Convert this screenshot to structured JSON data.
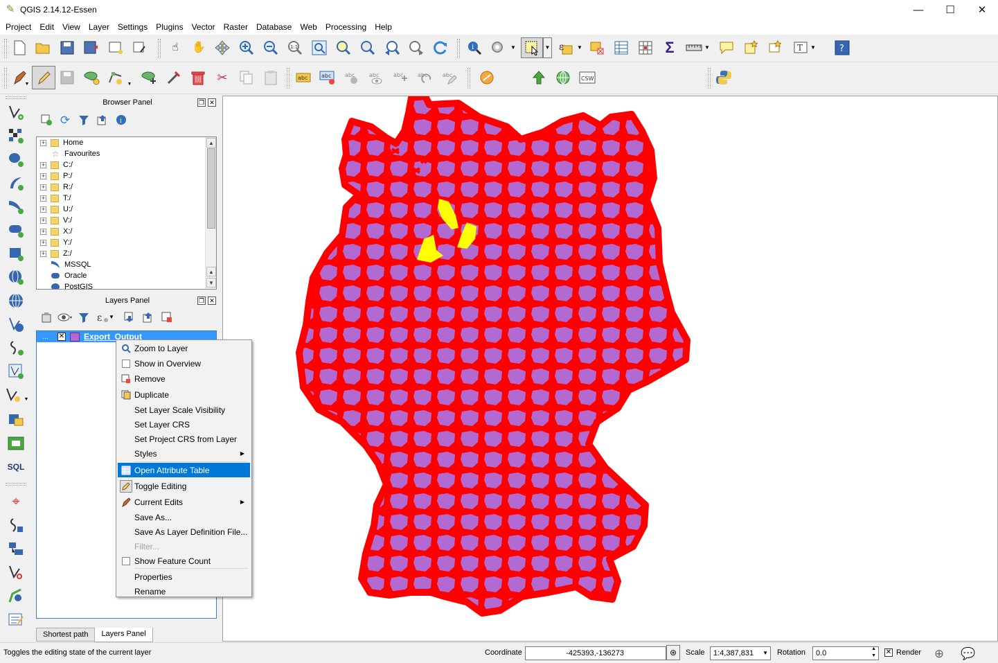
{
  "window": {
    "title": "QGIS 2.14.12-Essen",
    "minimize": "—",
    "maximize": "☐",
    "close": "✕"
  },
  "menu": [
    "Project",
    "Edit",
    "View",
    "Layer",
    "Settings",
    "Plugins",
    "Vector",
    "Raster",
    "Database",
    "Web",
    "Processing",
    "Help"
  ],
  "browser_panel": {
    "title": "Browser Panel",
    "items": [
      {
        "label": "Home",
        "icon": "folder-icon",
        "expandable": true
      },
      {
        "label": "Favourites",
        "icon": "star-icon",
        "expandable": false
      },
      {
        "label": "C:/",
        "icon": "folder-icon",
        "expandable": true
      },
      {
        "label": "P:/",
        "icon": "folder-icon",
        "expandable": true
      },
      {
        "label": "R:/",
        "icon": "folder-icon",
        "expandable": true
      },
      {
        "label": "T:/",
        "icon": "folder-icon",
        "expandable": true
      },
      {
        "label": "U:/",
        "icon": "folder-icon",
        "expandable": true
      },
      {
        "label": "V:/",
        "icon": "folder-icon",
        "expandable": true
      },
      {
        "label": "X:/",
        "icon": "folder-icon",
        "expandable": true
      },
      {
        "label": "Y:/",
        "icon": "folder-icon",
        "expandable": true
      },
      {
        "label": "Z:/",
        "icon": "folder-icon",
        "expandable": true
      },
      {
        "label": "MSSQL",
        "icon": "mssql-icon",
        "expandable": false
      },
      {
        "label": "Oracle",
        "icon": "oracle-icon",
        "expandable": false
      },
      {
        "label": "PostGIS",
        "icon": "postgis-icon",
        "expandable": false
      }
    ]
  },
  "layers_panel": {
    "title": "Layers Panel",
    "layer_name": "Export_Output"
  },
  "context_menu": {
    "items": [
      {
        "label": "Zoom to Layer",
        "icon": "zoom-layer-icon"
      },
      {
        "label": "Show in Overview",
        "icon": "checkbox-icon"
      },
      {
        "label": "Remove",
        "icon": "remove-layer-icon"
      },
      {
        "label": "Duplicate",
        "icon": "duplicate-icon"
      },
      {
        "label": "Set Layer Scale Visibility",
        "icon": ""
      },
      {
        "label": "Set Layer CRS",
        "icon": ""
      },
      {
        "label": "Set Project CRS from Layer",
        "icon": ""
      },
      {
        "label": "Styles",
        "icon": "",
        "submenu": true
      },
      {
        "label": "Open Attribute Table",
        "icon": "attribute-table-icon",
        "highlighted": true
      },
      {
        "label": "Toggle Editing",
        "icon": "pencil-icon"
      },
      {
        "label": "Current Edits",
        "icon": "edits-icon",
        "submenu": true
      },
      {
        "label": "Save As...",
        "icon": ""
      },
      {
        "label": "Save As Layer Definition File...",
        "icon": ""
      },
      {
        "label": "Filter...",
        "icon": "",
        "disabled": true
      },
      {
        "label": "Show Feature Count",
        "icon": "checkbox-icon"
      },
      {
        "label": "Properties",
        "icon": ""
      },
      {
        "label": "Rename",
        "icon": ""
      }
    ]
  },
  "bottom_tabs": [
    "Shortest path",
    "Layers Panel"
  ],
  "status": {
    "message": "Toggles the editing state of the current layer",
    "coordinate_label": "Coordinate",
    "coordinate_value": "-425393,-136273",
    "scale_label": "Scale",
    "scale_value": "1:4,387,831",
    "rotation_label": "Rotation",
    "rotation_value": "0.0",
    "render_label": "Render"
  },
  "left_toolbar": {
    "sql_label": "SQL"
  },
  "toolbar2": {
    "csw_label": "CSW"
  },
  "map": {
    "fill_color": "#b36ad0",
    "outline_color": "#ff0000",
    "selected_color": "#ffff00",
    "background": "#ffffff"
  }
}
